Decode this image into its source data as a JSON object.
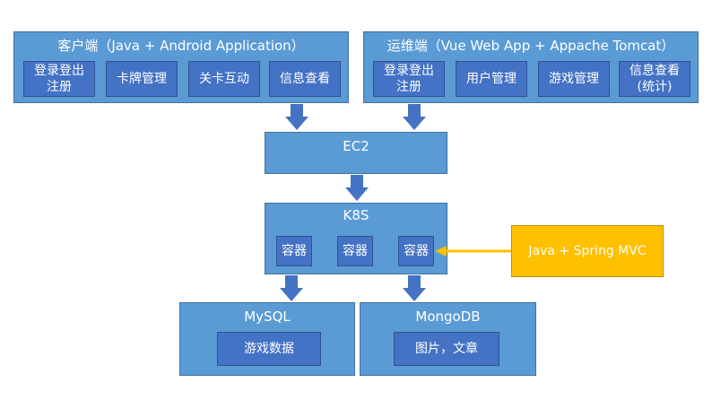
{
  "client": {
    "title": "客户端（Java + Android Application）",
    "modules": [
      "登录登出\n注册",
      "卡牌管理",
      "关卡互动",
      "信息查看"
    ]
  },
  "ops": {
    "title": "运维端（Vue Web App + Appache Tomcat）",
    "modules": [
      "登录登出\n注册",
      "用户管理",
      "游戏管理",
      "信息查看\n(统计)"
    ]
  },
  "ec2": {
    "title": "EC2"
  },
  "k8s": {
    "title": "K8S",
    "containers": [
      "容器",
      "容器",
      "容器"
    ]
  },
  "spring": {
    "label": "Java + Spring MVC"
  },
  "mysql": {
    "title": "MySQL",
    "content": "游戏数据"
  },
  "mongodb": {
    "title": "MongoDB",
    "content": "图片，文章"
  },
  "colors": {
    "outer_box": "#5b9bd5",
    "inner_box": "#4472c4",
    "highlight_box": "#ffc000",
    "arrow": "#4472c4",
    "highlight_arrow": "#ffc000"
  }
}
